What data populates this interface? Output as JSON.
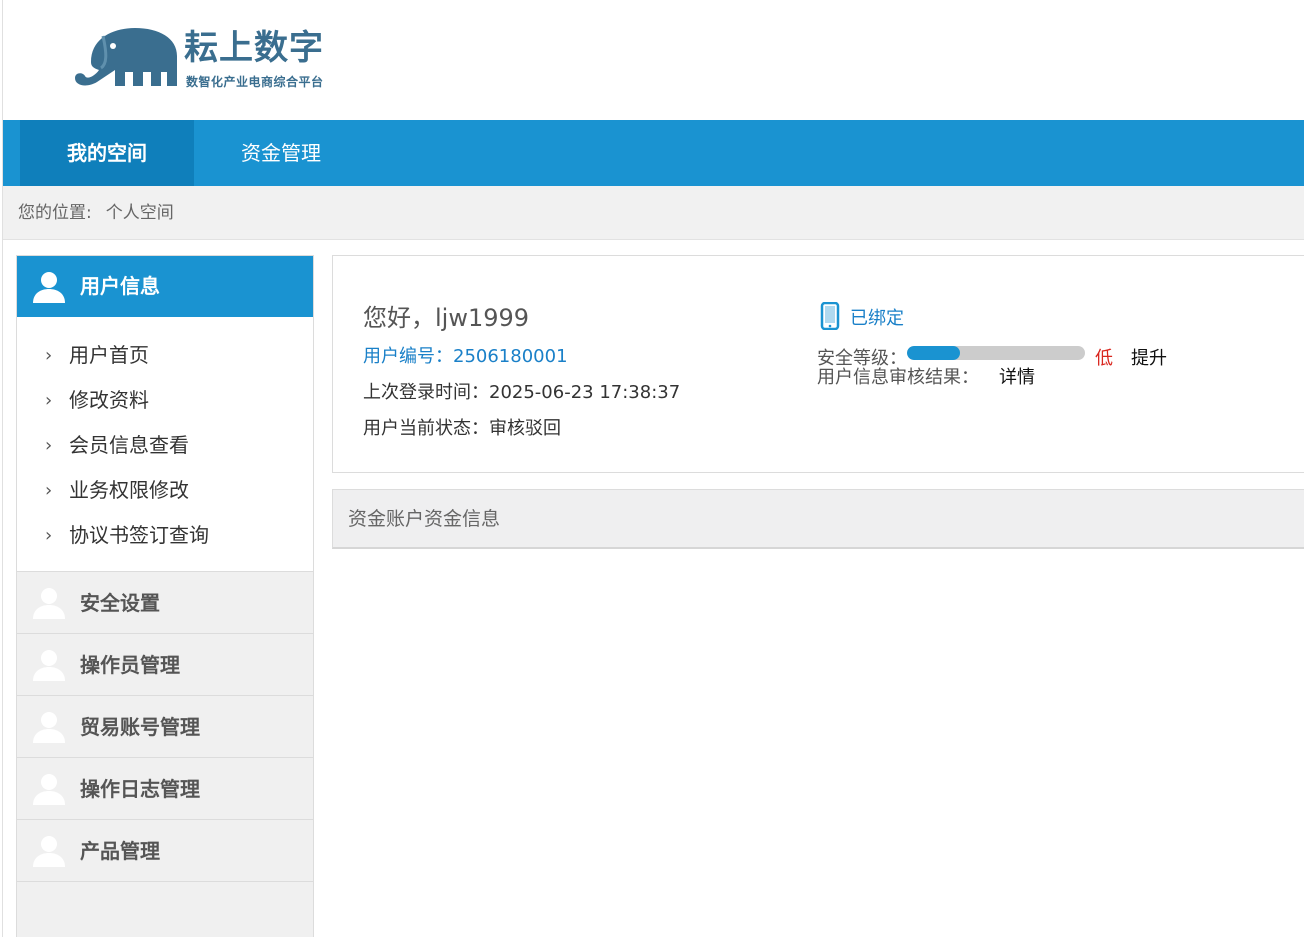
{
  "header": {
    "logo_title": "耘上数字",
    "logo_subtitle": "数智化产业电商综合平台"
  },
  "nav": {
    "items": [
      {
        "label": "我的空间",
        "active": true
      },
      {
        "label": "资金管理",
        "active": false
      }
    ]
  },
  "breadcrumb": {
    "prefix": "您的位置:",
    "current": "个人空间"
  },
  "sidebar": {
    "header": "用户信息",
    "links": [
      {
        "label": "用户首页"
      },
      {
        "label": "修改资料"
      },
      {
        "label": "会员信息查看"
      },
      {
        "label": "业务权限修改"
      },
      {
        "label": "协议书签订查询"
      }
    ],
    "groups": [
      {
        "label": "安全设置"
      },
      {
        "label": "操作员管理"
      },
      {
        "label": "贸易账号管理"
      },
      {
        "label": "操作日志管理"
      },
      {
        "label": "产品管理"
      }
    ],
    "chevron": "›",
    "icon": "person-icon"
  },
  "user": {
    "greeting": "您好，ljw1999",
    "user_id": "用户编号：2506180001",
    "last_login": "上次登录时间：2025-06-23 17:38:37",
    "status": "用户当前状态：审核驳回",
    "phone_bound": "已绑定",
    "security_label": "安全等级：",
    "security_level_text": "低",
    "security_progress": 0.3,
    "raise_label": "提升",
    "audit_label": "用户信息审核结果：",
    "audit_detail": "详情"
  },
  "fund": {
    "title": "资金账户资金信息"
  },
  "colors": {
    "primary": "#1a93d1",
    "primary_dark": "#0f7fbb",
    "link": "#1a80c8",
    "danger": "#d9251d"
  }
}
